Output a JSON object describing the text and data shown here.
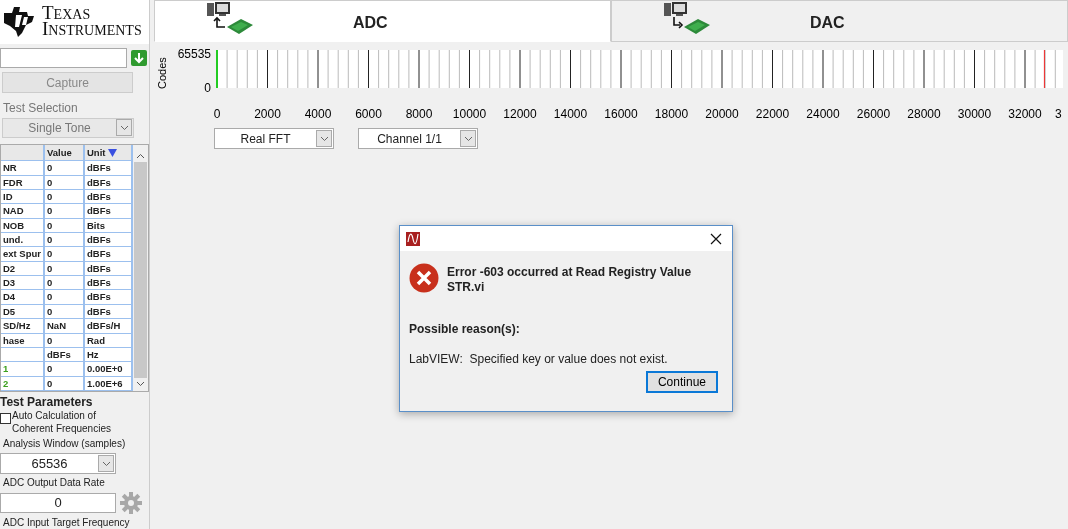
{
  "logo": {
    "line1": "TEXAS",
    "line2": "INSTRUMENTS"
  },
  "sidebar": {
    "capture_button": {
      "label": "Capture",
      "disabled": true
    },
    "test_selection": {
      "label": "Test Selection",
      "value": "Single Tone",
      "disabled": true
    },
    "table": {
      "columns": [
        "Value",
        "Unit"
      ],
      "rows": [
        {
          "name": "NR",
          "value": "0",
          "unit": "dBFs"
        },
        {
          "name": "FDR",
          "value": "0",
          "unit": "dBFs"
        },
        {
          "name": "ID",
          "value": "0",
          "unit": "dBFs"
        },
        {
          "name": "NAD",
          "value": "0",
          "unit": "dBFs"
        },
        {
          "name": "NOB",
          "value": "0",
          "unit": "Bits"
        },
        {
          "name": "und.",
          "value": "0",
          "unit": "dBFs"
        },
        {
          "name": "ext Spur",
          "value": "0",
          "unit": "dBFs"
        },
        {
          "name": "D2",
          "value": "0",
          "unit": "dBFs"
        },
        {
          "name": "D3",
          "value": "0",
          "unit": "dBFs"
        },
        {
          "name": "D4",
          "value": "0",
          "unit": "dBFs"
        },
        {
          "name": "D5",
          "value": "0",
          "unit": "dBFs"
        },
        {
          "name": "SD/Hz",
          "value": "NaN",
          "unit": "dBFs/H"
        },
        {
          "name": "hase",
          "value": "0",
          "unit": "Rad"
        },
        {
          "value": "dBFs",
          "unit": "Hz"
        },
        {
          "name": "1",
          "value": "0",
          "unit": "0.00E+0",
          "color": "#3ca01e"
        },
        {
          "name": "2",
          "value": "0",
          "unit": "1.00E+6",
          "color": "#3ca01e"
        }
      ]
    },
    "test_parameters": {
      "title": "Test Parameters",
      "auto_calc": {
        "label": "Auto Calculation of Coherent Frequencies",
        "checked": false
      },
      "analysis_window": {
        "label": "Analysis Window (samples)",
        "value": "65536"
      },
      "output_rate": {
        "label": "ADC Output Data Rate",
        "value": "0"
      },
      "target_frequency": {
        "label": "ADC Input Target Frequency"
      }
    }
  },
  "tabs": [
    {
      "label": "ADC",
      "selected": true,
      "kind": "adc"
    },
    {
      "label": "DAC",
      "selected": false,
      "kind": "dac"
    }
  ],
  "graph": {
    "ylabel": "Codes",
    "yticks": [
      "65535",
      "0"
    ],
    "xticks": [
      "0",
      "2000",
      "4000",
      "6000",
      "8000",
      "10000",
      "12000",
      "14000",
      "16000",
      "18000",
      "20000",
      "22000",
      "24000",
      "26000",
      "28000",
      "30000",
      "32000",
      "3"
    ]
  },
  "dropdowns": [
    {
      "value": "Real FFT"
    },
    {
      "value": "Channel 1/1"
    }
  ],
  "dialog": {
    "heading": "Error -603 occurred at Read Registry Value STR.vi",
    "reason_title": "Possible reason(s):",
    "reason": "LabVIEW:  Specified key or value does not exist.",
    "button": "Continue"
  }
}
